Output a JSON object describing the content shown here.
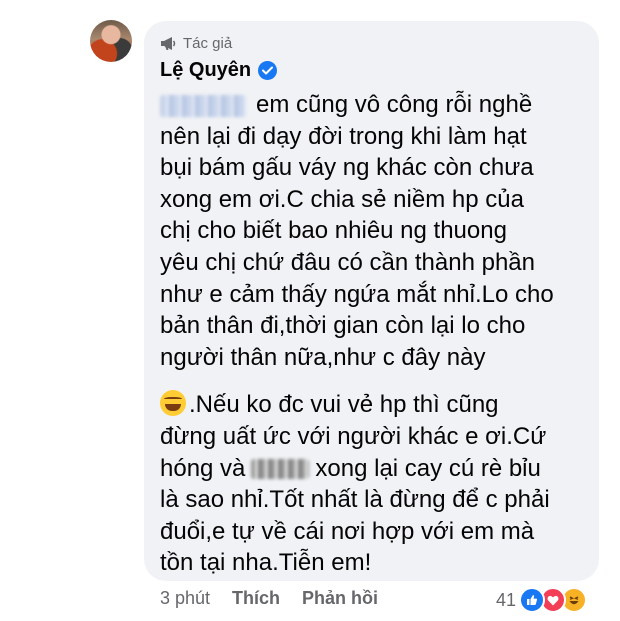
{
  "comment": {
    "badge_label": "Tác giả",
    "author_name": "Lệ Quyên",
    "body": {
      "para1": [
        "em cũng vô công rỗi nghề",
        "nên lại đi dạy đời trong khi làm hạt",
        "bụi bám gấu váy ng khác còn chưa",
        "xong em ơi.C chia sẻ niềm hp của",
        "chị cho biết bao nhiêu ng thuong",
        "yêu chị chứ đâu có cần thành phần",
        "như e cảm thấy ngứa mắt nhỉ.Lo cho",
        "bản thân đi,thời gian còn lại lo cho",
        "người thân nữa,như c đây này"
      ],
      "para2": [
        ".Nếu ko đc vui vẻ hp thì cũng",
        "đừng uất ức với người khác e ơi.Cứ",
        "hóng và",
        "xong lại cay cú rè bỉu",
        "là sao nhỉ.Tốt nhất là đừng để c phải",
        "đuổi,e tự về cái nơi hợp với em mà",
        "tồn tại nha.Tiễn em!"
      ]
    },
    "time": "3 phút",
    "like_label": "Thích",
    "reply_label": "Phản hồi",
    "reaction_count": "41",
    "reaction_icons": [
      "like-icon",
      "love-icon",
      "haha-icon"
    ]
  },
  "colors": {
    "bubble": "#f0f2f5",
    "verified": "#1877f2",
    "secondary_text": "#65676b"
  }
}
